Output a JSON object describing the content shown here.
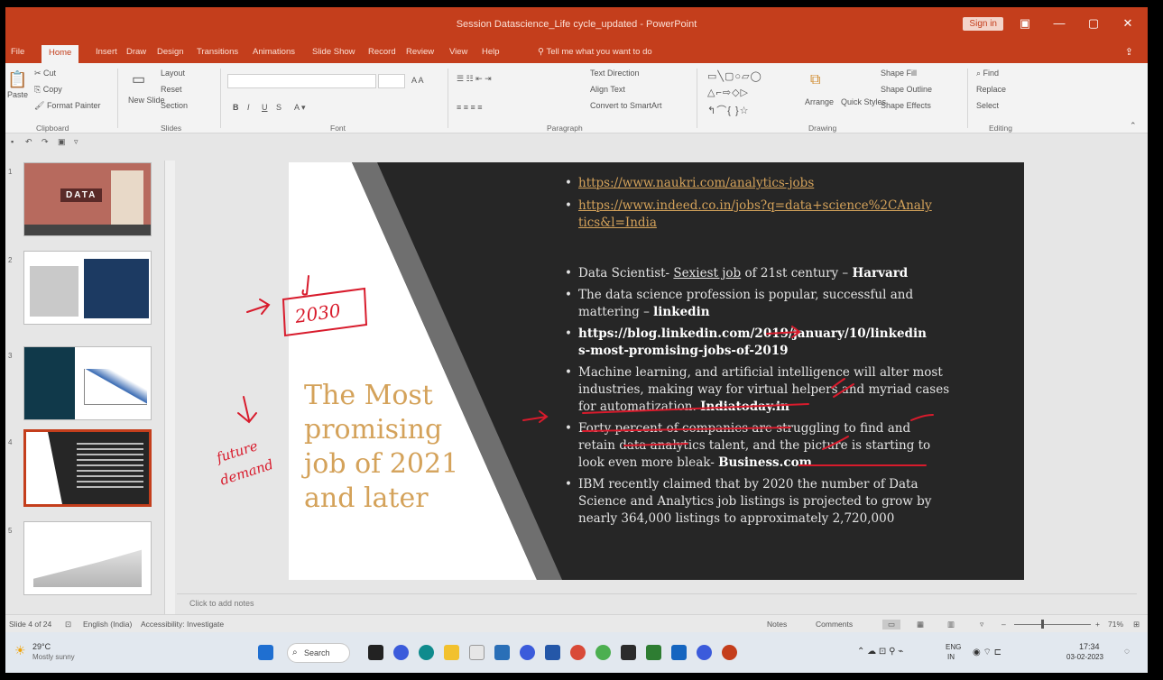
{
  "window": {
    "title": "Session Datascience_Life cycle_updated - PowerPoint",
    "sign_in": "Sign in",
    "minimize": "—",
    "restore": "▢",
    "close": "✕"
  },
  "ribbon_tabs": [
    "File",
    "Home",
    "Insert",
    "Draw",
    "Design",
    "Transitions",
    "Animations",
    "Slide Show",
    "Record",
    "Review",
    "View",
    "Help"
  ],
  "tell_me": "Tell me what you want to do",
  "ribbon": {
    "paste": "Paste",
    "cut": "Cut",
    "copy": "Copy",
    "format_painter": "Format Painter",
    "new_slide": "New Slide",
    "layout": "Layout",
    "reset": "Reset",
    "section": "Section",
    "text_direction": "Text Direction",
    "align_text": "Align Text",
    "convert_smartart": "Convert to SmartArt",
    "arrange": "Arrange",
    "quick_styles": "Quick Styles",
    "shape_fill": "Shape Fill",
    "shape_outline": "Shape Outline",
    "shape_effects": "Shape Effects",
    "find": "Find",
    "replace": "Replace",
    "select": "Select",
    "groups": {
      "clipboard": "Clipboard",
      "slides": "Slides",
      "font": "Font",
      "paragraph": "Paragraph",
      "drawing": "Drawing",
      "editing": "Editing"
    }
  },
  "slide": {
    "title_lines": [
      "The Most",
      "promising",
      "job of 2021",
      "and later"
    ],
    "bullets": {
      "link1": "https://www.naukri.com/analytics-jobs",
      "link2a": "https://www.indeed.co.in/jobs?q=data+science%2CAnaly",
      "link2b": "tics&l=India",
      "b3_pre": "Data Scientist- ",
      "b3_u": "Sexiest job",
      "b3_mid": " of 21st century – ",
      "b3_bold": "Harvard",
      "b4_line1": "The data science profession is popular, successful and",
      "b4_line2": "mattering – ",
      "b4_bold": "linkedin",
      "b5_line1": "https://blog.linkedin.com/2019/january/10/linkedin",
      "b5_line2": "s-most-promising-jobs-of-2019",
      "b6_line1": "Machine learning, and artificial intelligence will alter most",
      "b6_line2": "industries, making way for virtual helpers and myriad cases",
      "b6_line3": "for automatization. ",
      "b6_bold": "Indiatoday.in",
      "b7_line1": "Forty percent of companies are struggling to find and",
      "b7_line2": "retain data analytics talent, and the picture is starting to",
      "b7_line3": "look even more bleak- ",
      "b7_bold": "Business.com",
      "b8_line1": "IBM recently claimed that by 2020 the number of Data",
      "b8_line2": "Science and Analytics job listings is projected to grow by",
      "b8_line3": "nearly 364,000 listings to approximately 2,720,000"
    },
    "ink_year": "2030",
    "ink_words": [
      "future",
      "demand"
    ]
  },
  "thumbnails": [
    {
      "num": "1",
      "caption": "DATA"
    },
    {
      "num": "2",
      "caption": ""
    },
    {
      "num": "3",
      "caption": ""
    },
    {
      "num": "4",
      "caption": ""
    },
    {
      "num": "5",
      "caption": ""
    }
  ],
  "notes_placeholder": "Click to add notes",
  "status": {
    "slide_counter": "Slide 4 of 24",
    "language": "English (India)",
    "accessibility": "Accessibility: Investigate",
    "notes": "Notes",
    "comments": "Comments",
    "zoom": "71%"
  },
  "taskbar": {
    "weather_temp": "29°C",
    "weather_desc": "Mostly sunny",
    "search": "Search",
    "lang": "ENG",
    "lang2": "IN",
    "time": "17:34",
    "date": "03-02-2023"
  },
  "colors": {
    "accent": "#c43e1c",
    "slide_dark": "#262626",
    "slide_gold": "#d4a25a",
    "ink_red": "#d81b2c"
  }
}
